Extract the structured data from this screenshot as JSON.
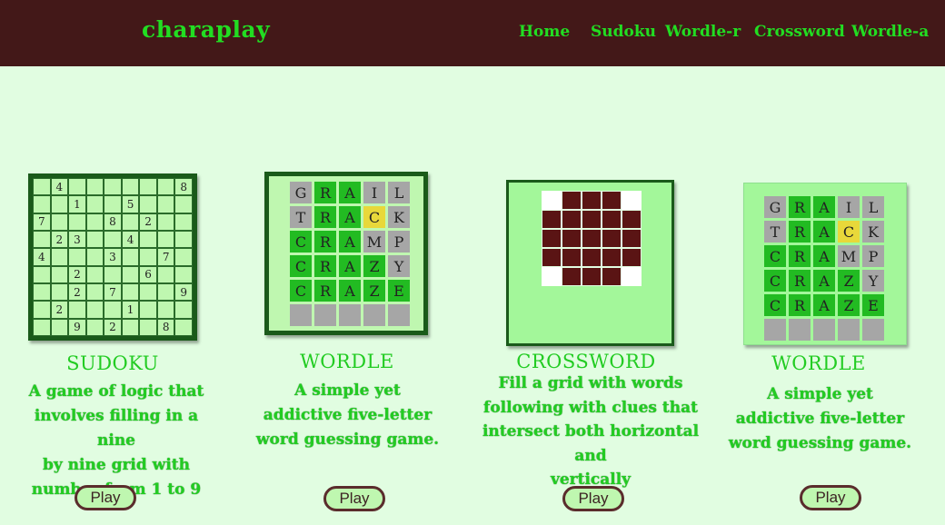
{
  "brand": "charaplay",
  "nav": [
    "Home",
    "Sudoku",
    "Wordle-r",
    "Crossword",
    "Wordle-a"
  ],
  "sudoku": {
    "title": "SUDOKU",
    "desc_lines": [
      "A game of logic that",
      "involves filling in a nine",
      "by nine grid with",
      "number from 1 to 9"
    ],
    "play": "Play",
    "grid": [
      [
        "",
        "4",
        "",
        "",
        "",
        "",
        "",
        "",
        "8"
      ],
      [
        "",
        "",
        "1",
        "",
        "",
        "5",
        "",
        "",
        ""
      ],
      [
        "7",
        "",
        "",
        "",
        "8",
        "",
        "2",
        "",
        ""
      ],
      [
        "",
        "2",
        "3",
        "",
        "",
        "4",
        "",
        "",
        ""
      ],
      [
        "4",
        "",
        "",
        "",
        "3",
        "",
        "",
        "7",
        ""
      ],
      [
        "",
        "",
        "2",
        "",
        "",
        "",
        "6",
        "",
        ""
      ],
      [
        "",
        "",
        "2",
        "",
        "7",
        "",
        "",
        "",
        "9"
      ],
      [
        "",
        "2",
        "",
        "",
        "",
        "1",
        "",
        "",
        ""
      ],
      [
        "",
        "",
        "9",
        "",
        "2",
        "",
        "",
        "8",
        ""
      ]
    ]
  },
  "wordle1": {
    "title": "WORDLE",
    "desc_lines": [
      "A simple yet",
      "addictive five-letter",
      "word guessing game."
    ],
    "play": "Play",
    "rows": [
      [
        [
          "G",
          "x"
        ],
        [
          "R",
          "g"
        ],
        [
          "A",
          "g"
        ],
        [
          "I",
          "x"
        ],
        [
          "L",
          "x"
        ]
      ],
      [
        [
          "T",
          "x"
        ],
        [
          "R",
          "g"
        ],
        [
          "A",
          "g"
        ],
        [
          "C",
          "y"
        ],
        [
          "K",
          "x"
        ]
      ],
      [
        [
          "C",
          "g"
        ],
        [
          "R",
          "g"
        ],
        [
          "A",
          "g"
        ],
        [
          "M",
          "x"
        ],
        [
          "P",
          "x"
        ]
      ],
      [
        [
          "C",
          "g"
        ],
        [
          "R",
          "g"
        ],
        [
          "A",
          "g"
        ],
        [
          "Z",
          "g"
        ],
        [
          "Y",
          "x"
        ]
      ],
      [
        [
          "C",
          "g"
        ],
        [
          "R",
          "g"
        ],
        [
          "A",
          "g"
        ],
        [
          "Z",
          "g"
        ],
        [
          "E",
          "g"
        ]
      ],
      [
        [
          "",
          "x"
        ],
        [
          "",
          "x"
        ],
        [
          "",
          "x"
        ],
        [
          "",
          "x"
        ],
        [
          "",
          "x"
        ]
      ]
    ]
  },
  "crossword": {
    "title": "CROSSWORD",
    "desc_lines": [
      "Fill a grid with words",
      "following with clues that",
      "intersect both horizontal and",
      "vertically"
    ],
    "play": "Play",
    "grid": [
      [
        "w",
        "b",
        "b",
        "b",
        "w"
      ],
      [
        "b",
        "b",
        "b",
        "b",
        "b"
      ],
      [
        "b",
        "b",
        "b",
        "b",
        "b"
      ],
      [
        "b",
        "b",
        "b",
        "b",
        "b"
      ],
      [
        "w",
        "b",
        "b",
        "b",
        "w"
      ]
    ]
  },
  "wordle2": {
    "title": "WORDLE",
    "desc_lines": [
      "A simple yet",
      "addictive five-letter",
      "word guessing game."
    ],
    "play": "Play",
    "rows": [
      [
        [
          "G",
          "x"
        ],
        [
          "R",
          "g"
        ],
        [
          "A",
          "g"
        ],
        [
          "I",
          "x"
        ],
        [
          "L",
          "x"
        ]
      ],
      [
        [
          "T",
          "x"
        ],
        [
          "R",
          "g"
        ],
        [
          "A",
          "g"
        ],
        [
          "C",
          "y"
        ],
        [
          "K",
          "x"
        ]
      ],
      [
        [
          "C",
          "g"
        ],
        [
          "R",
          "g"
        ],
        [
          "A",
          "g"
        ],
        [
          "M",
          "x"
        ],
        [
          "P",
          "x"
        ]
      ],
      [
        [
          "C",
          "g"
        ],
        [
          "R",
          "g"
        ],
        [
          "A",
          "g"
        ],
        [
          "Z",
          "g"
        ],
        [
          "Y",
          "x"
        ]
      ],
      [
        [
          "C",
          "g"
        ],
        [
          "R",
          "g"
        ],
        [
          "A",
          "g"
        ],
        [
          "Z",
          "g"
        ],
        [
          "E",
          "g"
        ]
      ],
      [
        [
          "",
          "x"
        ],
        [
          "",
          "x"
        ],
        [
          "",
          "x"
        ],
        [
          "",
          "x"
        ],
        [
          "",
          "x"
        ]
      ]
    ]
  },
  "colors": {
    "topbar": "#431818",
    "accent_green": "#22dd22",
    "background": "#e1fde1",
    "wordle_green": "#22bb22",
    "wordle_yellow": "#e8d83a",
    "wordle_gray": "#a6a6a6",
    "crossword_block": "#5a1414"
  }
}
